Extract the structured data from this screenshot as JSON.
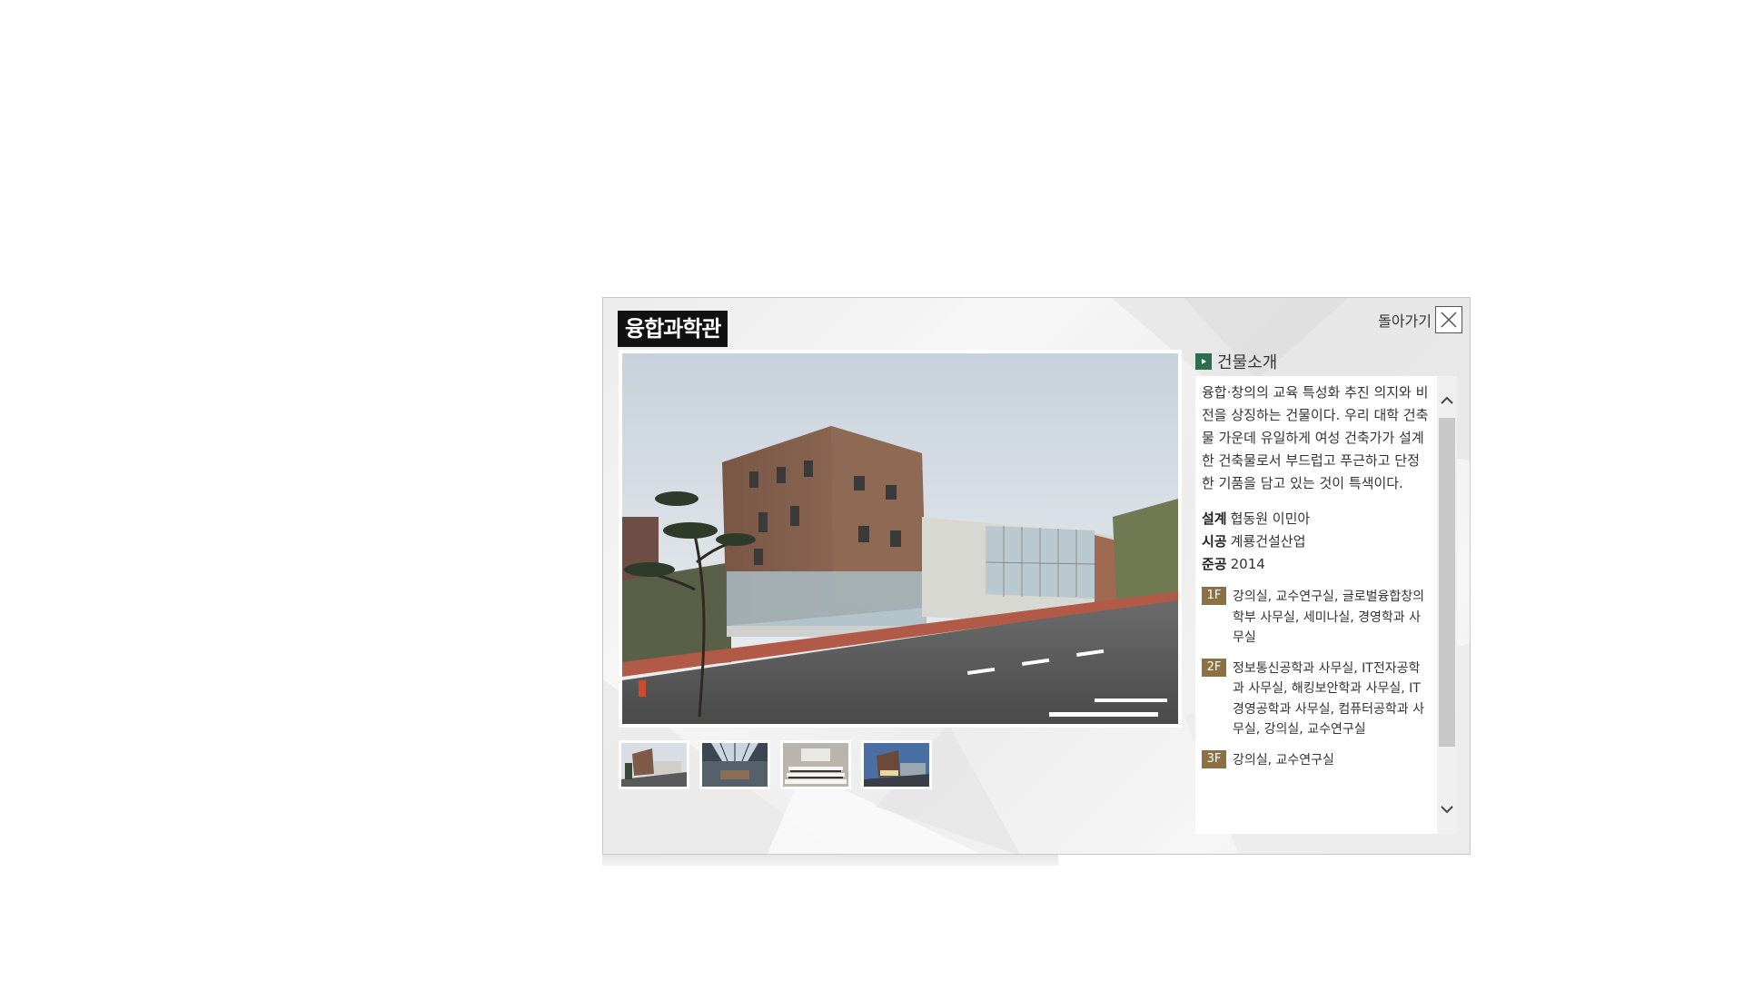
{
  "popup": {
    "title": "융합과학관",
    "back_label": "돌아가기",
    "close_icon": "close-icon"
  },
  "photo": {
    "alt": "융합과학관 building photo",
    "thumbnails": [
      "thumb-exterior",
      "thumb-atrium",
      "thumb-lecture-room",
      "thumb-exterior-night"
    ]
  },
  "info": {
    "heading": "건물소개",
    "description": "융합·창의의 교육 특성화 추진 의지와 비전을 상징하는 건물이다. 우리 대학 건축물 가운데 유일하게 여성 건축가가 설계한 건축물로서 부드럽고 푸근하고 단정한 기품을 담고 있는 것이 특색이다.",
    "design_label": "설계",
    "design_value": "협동원 이민아",
    "construction_label": "시공",
    "construction_value": "계룡건설산업",
    "completion_label": "준공",
    "completion_value": "2014",
    "floors": [
      {
        "badge": "1F",
        "text": "강의실, 교수연구실, 글로벌융합창의학부 사무실, 세미나실, 경영학과 사무실"
      },
      {
        "badge": "2F",
        "text": "정보통신공학과 사무실, IT전자공학과 사무실, 해킹보안학과 사무실, IT경영공학과 사무실, 컴퓨터공학과 사무실, 강의실, 교수연구실"
      },
      {
        "badge": "3F",
        "text": "강의실, 교수연구실"
      }
    ]
  },
  "colors": {
    "title_bg": "#111111",
    "heading_bullet": "#2e6e4f",
    "floor_badge": "#8b7143"
  }
}
